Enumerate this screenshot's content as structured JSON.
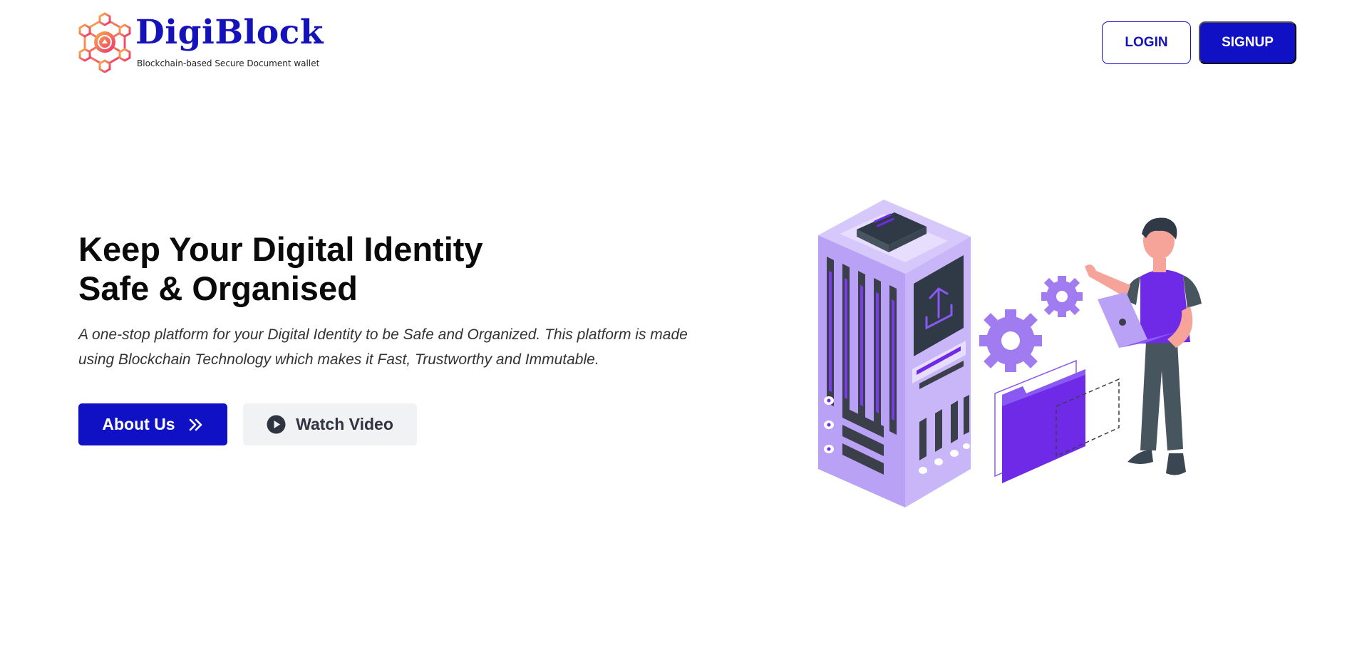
{
  "header": {
    "brand_name": "DigiBlock",
    "brand_tagline": "Blockchain-based Secure Document wallet",
    "login_label": "LOGIN",
    "signup_label": "SIGNUP"
  },
  "hero": {
    "title_line1": "Keep Your Digital Identity",
    "title_line2": "Safe & Organised",
    "description": "A one-stop platform for your Digital Identity to be Safe and Organized. This platform is made using Blockchain Technology which makes it Fast, Trustworthy and Immutable.",
    "about_label": "About Us",
    "video_label": "Watch Video"
  },
  "icons": {
    "logo": "hexagon-network-logo-icon",
    "about": "double-chevron-right-icon",
    "video": "play-circle-icon"
  },
  "colors": {
    "primary": "#1010c4",
    "brand_text": "#1412b8",
    "secondary_button_bg": "#f1f2f4",
    "illustration_purple": "#6e2ae6",
    "illustration_lavender": "#b9a1f5"
  }
}
